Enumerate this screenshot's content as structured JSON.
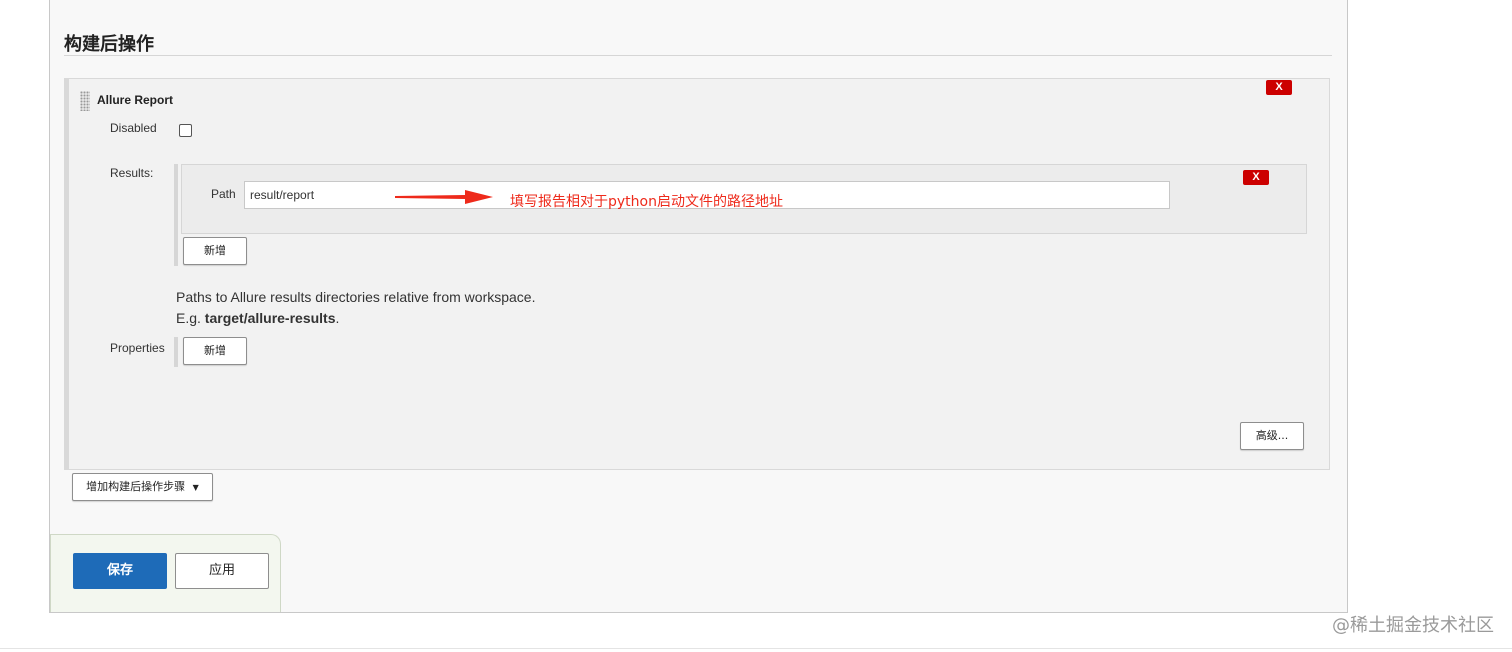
{
  "section": {
    "title": "构建后操作"
  },
  "allure": {
    "title": "Allure Report",
    "delete_label": "X",
    "disabled_label": "Disabled",
    "disabled_checked": false,
    "results_label": "Results:",
    "path_label": "Path",
    "path_value": "result/report",
    "path_delete_label": "X",
    "annotation": "填写报告相对于python启动文件的路径地址",
    "add_result_label": "新增",
    "help_line1": "Paths to Allure results directories relative from workspace.",
    "help_prefix": "E.g. ",
    "help_example": "target/allure-results",
    "help_suffix": ".",
    "properties_label": "Properties",
    "add_property_label": "新增",
    "advanced_label": "高级..."
  },
  "add_step": {
    "label": "增加构建后操作步骤",
    "icon": "caret-down-icon"
  },
  "actions": {
    "save_label": "保存",
    "apply_label": "应用"
  },
  "colors": {
    "annotation": "#ee2a1b",
    "delete_button": "#cc0000",
    "save_button": "#1e6bb8"
  },
  "watermark": "@稀土掘金技术社区"
}
